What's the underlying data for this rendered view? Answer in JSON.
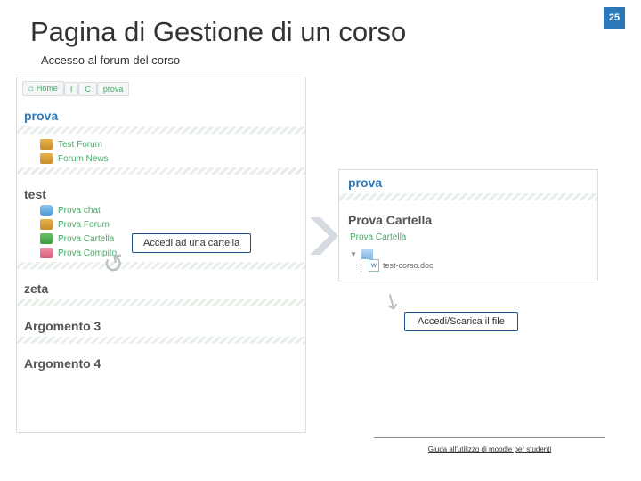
{
  "page_number": "25",
  "title": "Pagina di Gestione di un corso",
  "subtitle": "Accesso al forum del corso",
  "breadcrumbs": {
    "home": "Home",
    "b1": "I",
    "b2": "C",
    "b3": "prova"
  },
  "left": {
    "sec1": "prova",
    "sec1_items": {
      "a": "Test Forum",
      "b": "Forum News"
    },
    "sec2": "test",
    "sec2_items": {
      "a": "Prova chat",
      "b": "Prova Forum",
      "c": "Prova Cartella",
      "d": "Prova Compito"
    },
    "sec3": "zeta",
    "sec4": "Argomento 3",
    "sec5": "Argomento 4"
  },
  "callout1": "Accedi ad una cartella",
  "right": {
    "h1": "prova",
    "h2": "Prova Cartella",
    "link": "Prova Cartella",
    "file": "test-corso.doc"
  },
  "callout2": "Accedi/Scarica il file",
  "footer": "Giuda all'utilizzo di moodle per studenti"
}
